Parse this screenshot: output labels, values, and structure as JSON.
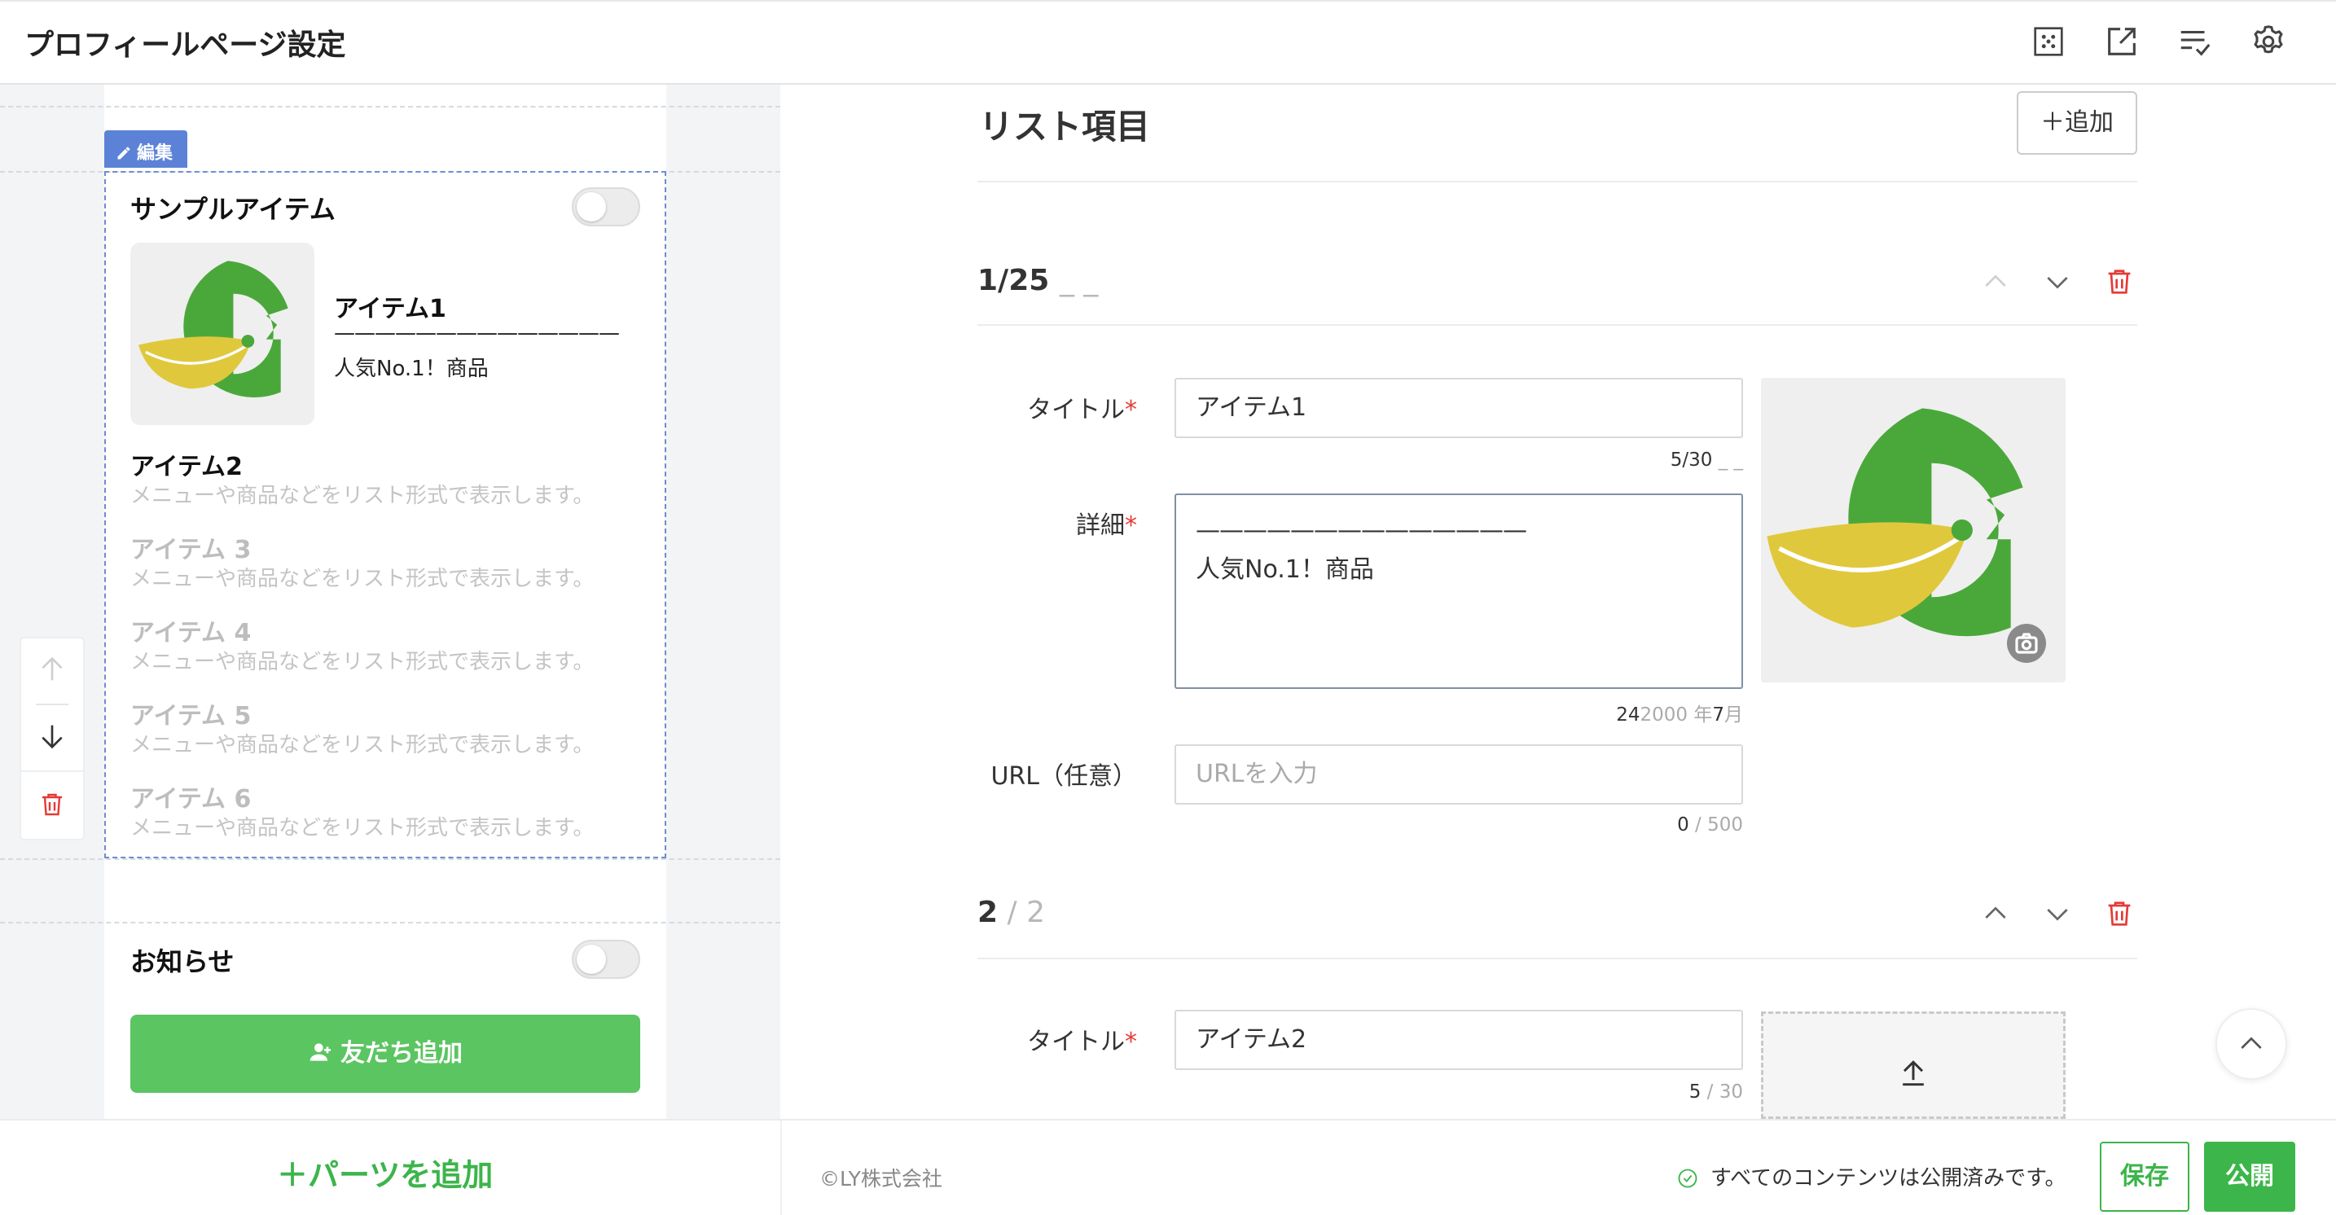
{
  "header": {
    "title": "プロフィールページ設定"
  },
  "preview": {
    "edit_tag": "編集",
    "section_title": "サンプルアイテム",
    "items": [
      {
        "title": "アイテム1",
        "desc_line1": "——————————————",
        "desc_line2": "人気No.1！商品"
      },
      {
        "title": "アイテム2",
        "desc": "メニューや商品などをリスト形式で表示します。"
      },
      {
        "title": "アイテム 3",
        "desc": "メニューや商品などをリスト形式で表示します。"
      },
      {
        "title": "アイテム 4",
        "desc": "メニューや商品などをリスト形式で表示します。"
      },
      {
        "title": "アイテム 5",
        "desc": "メニューや商品などをリスト形式で表示します。"
      },
      {
        "title": "アイテム 6",
        "desc": "メニューや商品などをリスト形式で表示します。"
      }
    ],
    "news_title": "お知らせ",
    "add_friend_label": "友だち追加"
  },
  "editor": {
    "heading": "リスト項目",
    "add_label": "＋追加",
    "item1": {
      "counter": "1/25",
      "counter_suffix": "_ _",
      "title_label": "タイトル",
      "title_value": "アイテム1",
      "title_count": "5/30",
      "title_count_suffix": "_ _",
      "detail_label": "詳細",
      "detail_line1": "——————————————",
      "detail_line2": "人気No.1！商品",
      "detail_count": "24",
      "detail_count_rest": "2000 年",
      "detail_count_month": "7",
      "detail_count_tail": "月",
      "url_label": "URL（任意）",
      "url_placeholder": "URLを入力",
      "url_count": "0",
      "url_count_max": " / 500"
    },
    "item2": {
      "counter": "2",
      "counter_total": " / 2",
      "title_label": "タイトル",
      "title_value": "アイテム2",
      "title_count": "5",
      "title_count_max": " / 30"
    },
    "required_mark": "*"
  },
  "footer": {
    "add_parts": "＋パーツを追加",
    "copyright": "©LY株式会社",
    "status": "すべてのコンテンツは公開済みです。",
    "save": "保存",
    "publish": "公開"
  },
  "colors": {
    "accent_green": "#3cb54a",
    "friend_button": "#5bc561",
    "edit_blue": "#5c82d8",
    "delete_red": "#e53935"
  }
}
